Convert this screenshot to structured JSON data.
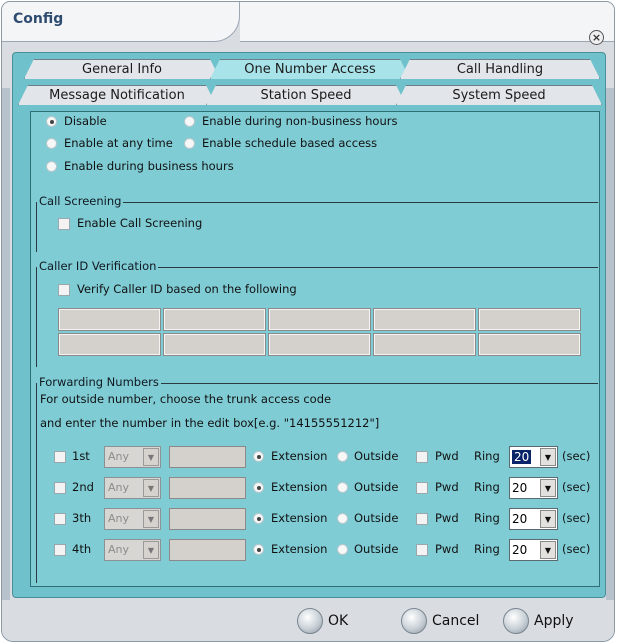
{
  "window": {
    "title": "Config",
    "close_symbol": "×"
  },
  "tabs_row1": [
    {
      "label": "General Info"
    },
    {
      "label": "One Number Access"
    },
    {
      "label": "Call Handling"
    }
  ],
  "tabs_row2": [
    {
      "label": "Message Notification"
    },
    {
      "label": "Station Speed"
    },
    {
      "label": "System Speed"
    }
  ],
  "access": {
    "options": [
      {
        "label": "Disable"
      },
      {
        "label": "Enable during non-business hours"
      },
      {
        "label": "Enable at any time"
      },
      {
        "label": "Enable schedule based access"
      },
      {
        "label": "Enable during business hours"
      }
    ]
  },
  "call_screening": {
    "title": "Call Screening",
    "checkbox_label": "Enable Call Screening"
  },
  "caller_id": {
    "title": "Caller ID Verification",
    "checkbox_label": "Verify Caller ID based on the following"
  },
  "forwarding": {
    "title": "Forwarding Numbers",
    "line1": "For outside number, choose the trunk access code",
    "line2": "and enter the number in the edit box[e.g. \"14155551212\"]",
    "extension_label": "Extension",
    "outside_label": "Outside",
    "pwd_label": "Pwd",
    "ring_label": "Ring",
    "unit_label": "(sec)",
    "rows": [
      {
        "label": "1st",
        "trunk": "Any",
        "ring": "20"
      },
      {
        "label": "2nd",
        "trunk": "Any",
        "ring": "20"
      },
      {
        "label": "3th",
        "trunk": "Any",
        "ring": "20"
      },
      {
        "label": "4th",
        "trunk": "Any",
        "ring": "20"
      }
    ]
  },
  "buttons": {
    "ok": "OK",
    "cancel": "Cancel",
    "apply": "Apply"
  },
  "icons": {
    "arrow": "▼"
  }
}
